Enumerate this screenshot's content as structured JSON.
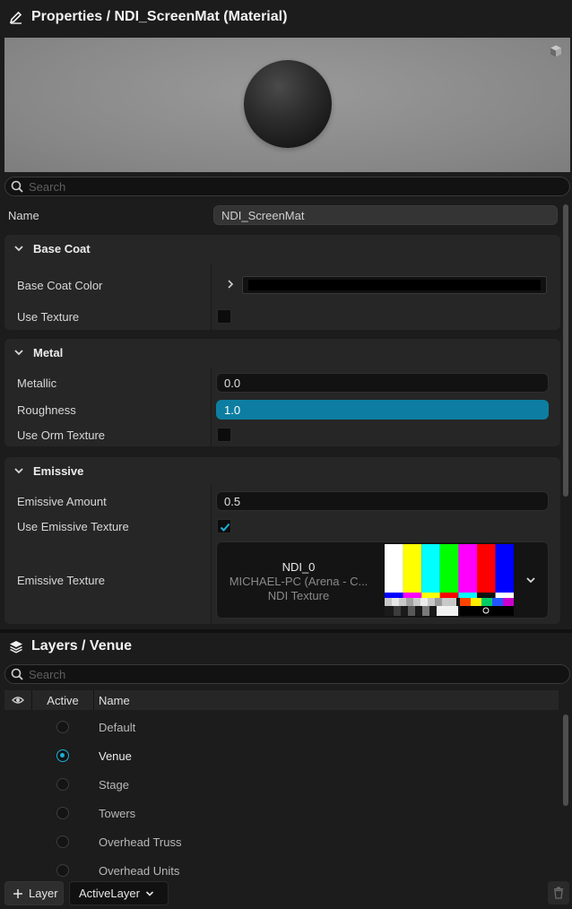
{
  "properties_panel": {
    "title": "Properties / NDI_ScreenMat (Material)",
    "title_icon": "pencil-icon",
    "preview_toggle_icon": "cube-icon",
    "search": {
      "placeholder": "Search",
      "value": ""
    },
    "name": {
      "label": "Name",
      "value": "NDI_ScreenMat"
    },
    "base_coat": {
      "header": "Base Coat",
      "color_label": "Base Coat Color",
      "color_value": "#000000",
      "use_texture_label": "Use Texture",
      "use_texture": false
    },
    "metal": {
      "header": "Metal",
      "metallic_label": "Metallic",
      "metallic_value": "0.0",
      "roughness_label": "Roughness",
      "roughness_value": "1.0",
      "roughness_fraction": 1.0,
      "use_orm_label": "Use Orm Texture",
      "use_orm": false
    },
    "emissive": {
      "header": "Emissive",
      "amount_label": "Emissive Amount",
      "amount_value": "0.5",
      "use_texture_label": "Use Emissive Texture",
      "use_texture": true,
      "texture_label": "Emissive Texture",
      "texture_name": "NDI_0",
      "texture_source": "MICHAEL-PC (Arena - C...",
      "texture_type": "NDI Texture"
    }
  },
  "layers_panel": {
    "title": "Layers / Venue",
    "title_icon": "layers-icon",
    "search": {
      "placeholder": "Search",
      "value": ""
    },
    "columns": {
      "visibility_icon": "eye-icon",
      "active": "Active",
      "name": "Name"
    },
    "rows": [
      {
        "name": "Default",
        "active": false
      },
      {
        "name": "Venue",
        "active": true
      },
      {
        "name": "Stage",
        "active": false
      },
      {
        "name": "Towers",
        "active": false
      },
      {
        "name": "Overhead Truss",
        "active": false
      },
      {
        "name": "Overhead Units",
        "active": false
      }
    ],
    "add_button": "Layer",
    "add_icon": "plus-icon",
    "active_layer_dropdown": "ActiveLayer",
    "delete_icon": "trash-icon"
  },
  "colors": {
    "accent": "#1ab0d8",
    "slider_fill": "#0d7ea1",
    "background": "#1c1c1c",
    "section": "#262626"
  }
}
